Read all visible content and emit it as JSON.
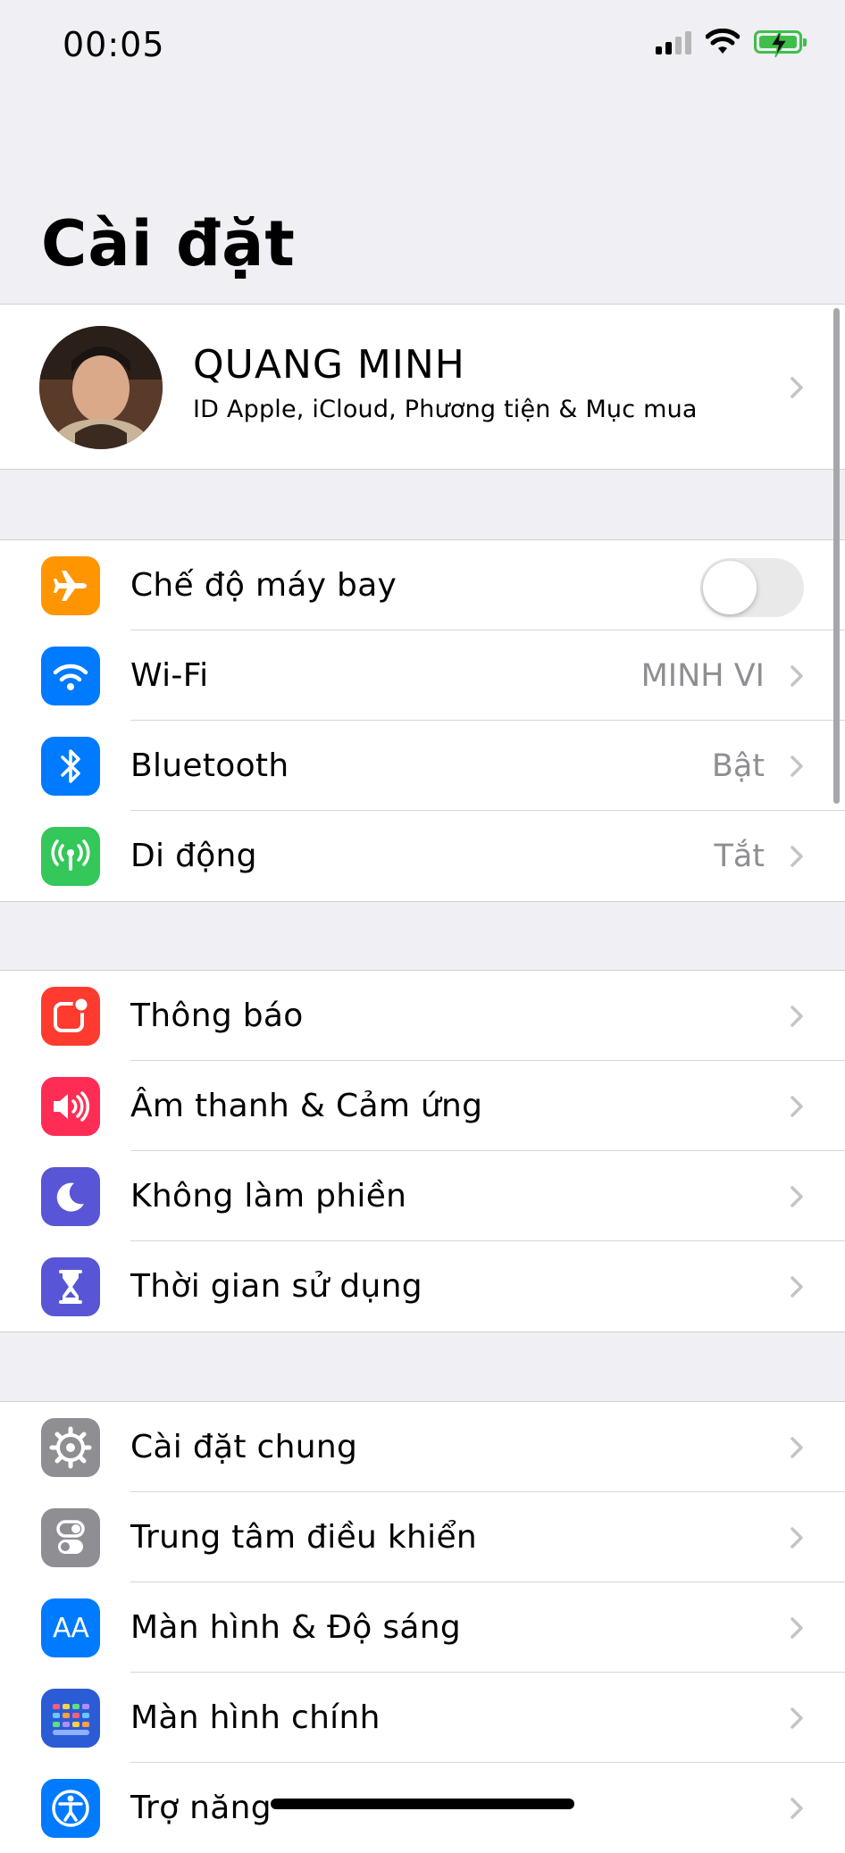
{
  "status_bar": {
    "time": "00:05",
    "battery_charging": true
  },
  "title": "Cài đặt",
  "profile": {
    "name": "QUANG MINH",
    "subtitle": "ID Apple, iCloud, Phương tiện & Mục mua"
  },
  "group1": [
    {
      "label": "Chế độ máy bay",
      "icon": "airplane-icon",
      "color": "#ff9500",
      "toggle": false
    },
    {
      "label": "Wi-Fi",
      "icon": "wifi-icon",
      "color": "#007aff",
      "value": "MINH VI"
    },
    {
      "label": "Bluetooth",
      "icon": "bluetooth-icon",
      "color": "#007aff",
      "value": "Bật"
    },
    {
      "label": "Di động",
      "icon": "cellular-icon",
      "color": "#34c759",
      "value": "Tắt"
    }
  ],
  "group2": [
    {
      "label": "Thông báo",
      "icon": "notifications-icon",
      "color": "#ff3b30"
    },
    {
      "label": "Âm thanh & Cảm ứng",
      "icon": "sound-icon",
      "color": "#ff2d55"
    },
    {
      "label": "Không làm phiền",
      "icon": "moon-icon",
      "color": "#5856d6"
    },
    {
      "label": "Thời gian sử dụng",
      "icon": "hourglass-icon",
      "color": "#5856d6"
    }
  ],
  "group3": [
    {
      "label": "Cài đặt chung",
      "icon": "gear-icon",
      "color": "#8e8e93"
    },
    {
      "label": "Trung tâm điều khiển",
      "icon": "control-center-icon",
      "color": "#8e8e93"
    },
    {
      "label": "Màn hình & Độ sáng",
      "icon": "display-brightness-icon",
      "color": "#007aff",
      "icon_text": "AA"
    },
    {
      "label": "Màn hình chính",
      "icon": "home-screen-icon",
      "color": "#2c5bd6"
    },
    {
      "label": "Trợ năng",
      "icon": "accessibility-icon",
      "color": "#007aff"
    }
  ]
}
